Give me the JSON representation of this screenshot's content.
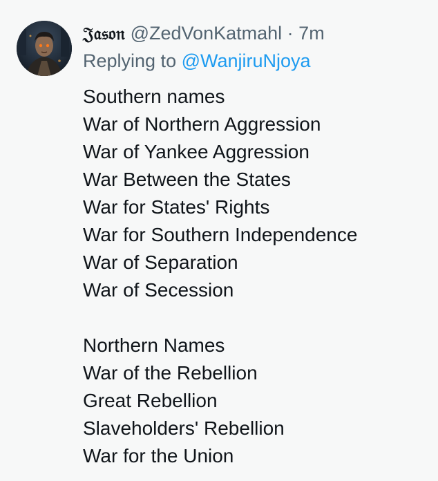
{
  "tweet": {
    "author": {
      "display_name": "𝔍𝔞𝔰𝔬𝔫",
      "handle": "@ZedVonKatmahl",
      "separator": "·",
      "time": "7m",
      "avatar_icon": "user-avatar-portrait"
    },
    "reply": {
      "prefix": "Replying to",
      "mention": "@WanjiruNjoya"
    },
    "sections": [
      {
        "heading": "Southern names",
        "items": [
          "War of Northern Aggression",
          "War of Yankee Aggression",
          "War Between the States",
          "War for States' Rights",
          "War for Southern Independence",
          "War of Separation",
          "War of Secession"
        ]
      },
      {
        "heading": "Northern Names",
        "items": [
          "War of the Rebellion",
          "Great Rebellion",
          "Slaveholders' Rebellion",
          "War for the Union"
        ]
      }
    ]
  },
  "colors": {
    "background": "#f7f8f8",
    "text": "#0f1419",
    "secondary": "#536471",
    "link": "#1d9bf0"
  }
}
